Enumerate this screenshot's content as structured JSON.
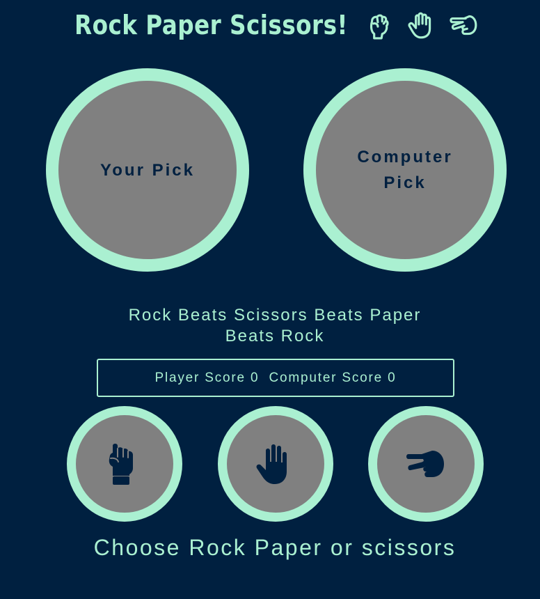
{
  "title": {
    "text": "Rock Paper Scissors!",
    "icons": [
      "rock-hand-icon",
      "paper-hand-icon",
      "scissors-hand-icon"
    ]
  },
  "picks": {
    "player_label": "Your Pick",
    "computer_label": "Computer Pick"
  },
  "rule_text": "Rock Beats Scissors Beats Paper Beats Rock",
  "score": {
    "text": "Player Score 0  Computer Score 0",
    "player": 0,
    "computer": 0
  },
  "choices": [
    {
      "name": "rock",
      "icon": "fist-icon"
    },
    {
      "name": "paper",
      "icon": "hand-paper-icon"
    },
    {
      "name": "scissors",
      "icon": "hand-scissors-icon"
    }
  ],
  "message": "Choose Rock Paper or scissors",
  "colors": {
    "background": "#002040",
    "accent": "#aaf0d1",
    "circle_fill": "#808080",
    "icon_fill": "#002040"
  }
}
